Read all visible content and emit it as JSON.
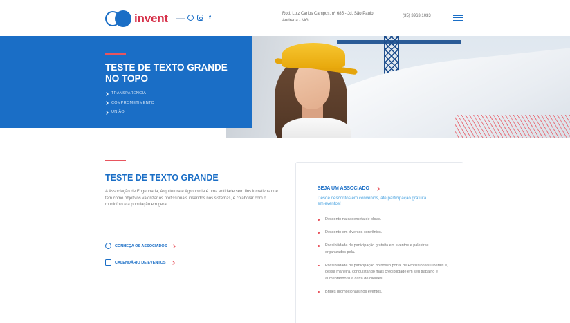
{
  "header": {
    "logo_text": "invent",
    "address": "Rod. Luiz Carlos Campos, nº 685 - Jd. São Paulo Andrada - MG",
    "phone": "(35) 3963 1033",
    "social_icons": [
      "whatsapp-icon",
      "instagram-icon",
      "facebook-icon"
    ]
  },
  "hero": {
    "title": "TESTE DE TEXTO GRANDE NO TOPO",
    "items": [
      "TRANSPARÊNCIA",
      "COMPROMETIMENTO",
      "UNIÃO"
    ]
  },
  "section": {
    "title": "TESTE DE TEXTO GRANDE",
    "text": "A Associação de Engenharia, Arquitetura e Agronomia é uma entidade sem fins lucrativos que tem como objetivos valorizar os profissionais inseridos nos sistemas, e colaborar com o município e a população em geral.",
    "actions": [
      {
        "label": "CONHEÇA OS ASSOCIADOS",
        "icon": "user-icon"
      },
      {
        "label": "CALENDÁRIO DE EVENTOS",
        "icon": "calendar-icon"
      }
    ]
  },
  "card": {
    "title": "SEJA UM ASSOCIADO",
    "subtitle": "Desde descontos em convênios, até participação gratuita em eventos!",
    "benefits": [
      "Desconto na caderneta de obras.",
      "Desconto em diversos convênios.",
      "Possibilidade de participação gratuita em eventos e palestras organizados pela.",
      "Possibilidade de participação do nosso portal de Profissionais Liberais e, dessa maneira, conquistando mais credibilidade em seu trabalho e aumentando sua carta de clientes.",
      "Brides promocionais nos eventos."
    ]
  },
  "colors": {
    "primary": "#1a6ec6",
    "accent": "#e8555e",
    "logo_text": "#d6314a"
  }
}
